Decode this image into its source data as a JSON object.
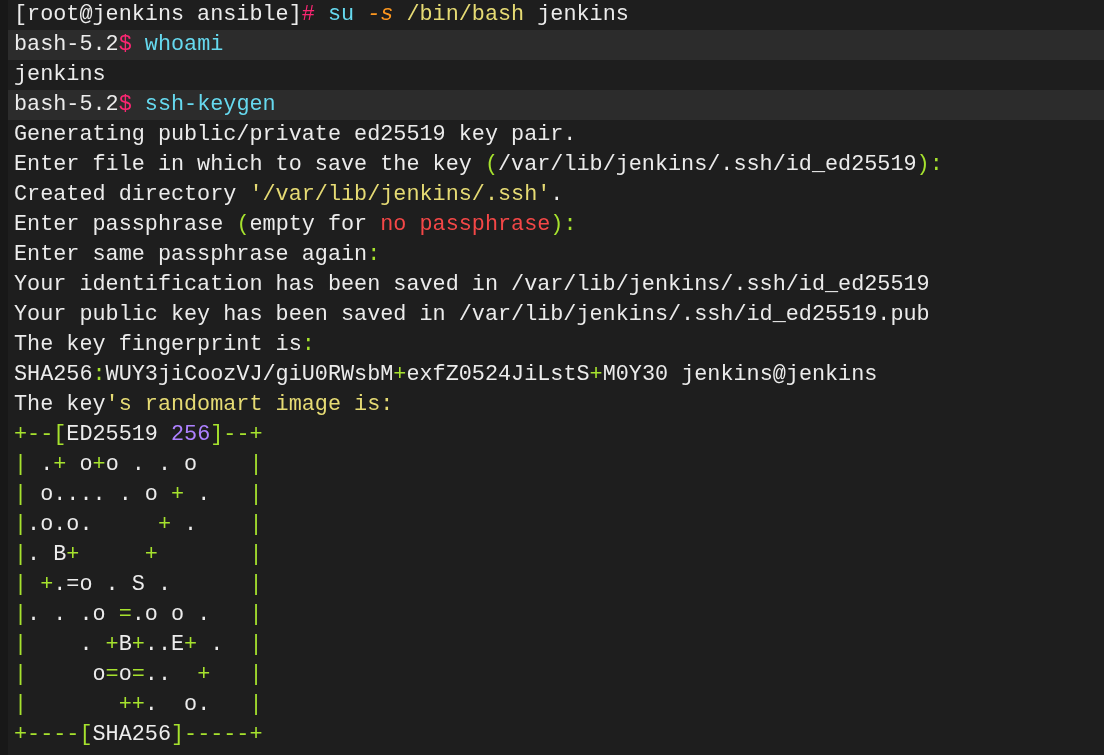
{
  "terminal": {
    "lines": [
      {
        "highlighted": false,
        "segments": [
          {
            "text": "[root@jenkins ansible]",
            "kind": "plain"
          },
          {
            "text": "#",
            "kind": "prompt"
          },
          {
            "text": " su",
            "kind": "command"
          },
          {
            "text": " -s",
            "kind": "flag"
          },
          {
            "text": " /bin/bash",
            "kind": "string"
          },
          {
            "text": " jenkins",
            "kind": "plain"
          }
        ]
      },
      {
        "highlighted": true,
        "segments": [
          {
            "text": "bash-5.2",
            "kind": "plain"
          },
          {
            "text": "$",
            "kind": "prompt"
          },
          {
            "text": " whoami",
            "kind": "command"
          }
        ]
      },
      {
        "highlighted": false,
        "segments": [
          {
            "text": "jenkins",
            "kind": "plain"
          }
        ]
      },
      {
        "highlighted": true,
        "segments": [
          {
            "text": "bash-5.2",
            "kind": "plain"
          },
          {
            "text": "$",
            "kind": "prompt"
          },
          {
            "text": " ssh-keygen",
            "kind": "command"
          }
        ]
      },
      {
        "highlighted": false,
        "segments": [
          {
            "text": "Generating public/private ed25519 key pair.",
            "kind": "plain"
          }
        ]
      },
      {
        "highlighted": false,
        "segments": [
          {
            "text": "Enter file in which to save the key ",
            "kind": "plain"
          },
          {
            "text": "(",
            "kind": "punct"
          },
          {
            "text": "/var/lib/jenkins/.ssh/id_ed25519",
            "kind": "plain"
          },
          {
            "text": "):",
            "kind": "punct"
          }
        ]
      },
      {
        "highlighted": false,
        "segments": [
          {
            "text": "Created directory ",
            "kind": "plain"
          },
          {
            "text": "'/var/lib/jenkins/.ssh'",
            "kind": "string"
          },
          {
            "text": ".",
            "kind": "plain"
          }
        ]
      },
      {
        "highlighted": false,
        "segments": [
          {
            "text": "Enter passphrase ",
            "kind": "plain"
          },
          {
            "text": "(",
            "kind": "punct"
          },
          {
            "text": "empty for ",
            "kind": "plain"
          },
          {
            "text": "no passphrase",
            "kind": "error"
          },
          {
            "text": "):",
            "kind": "punct"
          }
        ]
      },
      {
        "highlighted": false,
        "segments": [
          {
            "text": "Enter same passphrase again",
            "kind": "plain"
          },
          {
            "text": ":",
            "kind": "punct"
          }
        ]
      },
      {
        "highlighted": false,
        "segments": [
          {
            "text": "Your identification has been saved in /var/lib/jenkins/.ssh/id_ed25519",
            "kind": "plain"
          }
        ]
      },
      {
        "highlighted": false,
        "segments": [
          {
            "text": "Your public key has been saved in /var/lib/jenkins/.ssh/id_ed25519.pub",
            "kind": "plain"
          }
        ]
      },
      {
        "highlighted": false,
        "segments": [
          {
            "text": "The key fingerprint is",
            "kind": "plain"
          },
          {
            "text": ":",
            "kind": "punct"
          }
        ]
      },
      {
        "highlighted": false,
        "segments": [
          {
            "text": "SHA256",
            "kind": "plain"
          },
          {
            "text": ":",
            "kind": "punct"
          },
          {
            "text": "WUY3jiCoozVJ/giU0RWsbM",
            "kind": "plain"
          },
          {
            "text": "+",
            "kind": "punct"
          },
          {
            "text": "exfZ0524JiLstS",
            "kind": "plain"
          },
          {
            "text": "+",
            "kind": "punct"
          },
          {
            "text": "M0Y30 jenkins@jenkins",
            "kind": "plain"
          }
        ]
      },
      {
        "highlighted": false,
        "segments": [
          {
            "text": "The key",
            "kind": "plain"
          },
          {
            "text": "'s randomart image is:",
            "kind": "string"
          }
        ]
      },
      {
        "highlighted": false,
        "segments": [
          {
            "text": "+--[",
            "kind": "punct"
          },
          {
            "text": "ED25519 ",
            "kind": "plain"
          },
          {
            "text": "256",
            "kind": "number"
          },
          {
            "text": "]--+",
            "kind": "punct"
          }
        ]
      },
      {
        "highlighted": false,
        "segments": [
          {
            "text": "|",
            "kind": "punct"
          },
          {
            "text": " .",
            "kind": "plain"
          },
          {
            "text": "+",
            "kind": "punct"
          },
          {
            "text": " o",
            "kind": "plain"
          },
          {
            "text": "+",
            "kind": "punct"
          },
          {
            "text": "o . . o    ",
            "kind": "plain"
          },
          {
            "text": "|",
            "kind": "punct"
          }
        ]
      },
      {
        "highlighted": false,
        "segments": [
          {
            "text": "|",
            "kind": "punct"
          },
          {
            "text": " o.... . o ",
            "kind": "plain"
          },
          {
            "text": "+",
            "kind": "punct"
          },
          {
            "text": " .   ",
            "kind": "plain"
          },
          {
            "text": "|",
            "kind": "punct"
          }
        ]
      },
      {
        "highlighted": false,
        "segments": [
          {
            "text": "|",
            "kind": "punct"
          },
          {
            "text": ".o.o.     ",
            "kind": "plain"
          },
          {
            "text": "+",
            "kind": "punct"
          },
          {
            "text": " .    ",
            "kind": "plain"
          },
          {
            "text": "|",
            "kind": "punct"
          }
        ]
      },
      {
        "highlighted": false,
        "segments": [
          {
            "text": "|",
            "kind": "punct"
          },
          {
            "text": ". B",
            "kind": "plain"
          },
          {
            "text": "+     +       |",
            "kind": "punct"
          }
        ]
      },
      {
        "highlighted": false,
        "segments": [
          {
            "text": "| +",
            "kind": "punct"
          },
          {
            "text": ".=o . S .      ",
            "kind": "plain"
          },
          {
            "text": "|",
            "kind": "punct"
          }
        ]
      },
      {
        "highlighted": false,
        "segments": [
          {
            "text": "|",
            "kind": "punct"
          },
          {
            "text": ". . .o ",
            "kind": "plain"
          },
          {
            "text": "=",
            "kind": "punct"
          },
          {
            "text": ".o o .   ",
            "kind": "plain"
          },
          {
            "text": "|",
            "kind": "punct"
          }
        ]
      },
      {
        "highlighted": false,
        "segments": [
          {
            "text": "|",
            "kind": "punct"
          },
          {
            "text": "    . ",
            "kind": "plain"
          },
          {
            "text": "+",
            "kind": "punct"
          },
          {
            "text": "B",
            "kind": "plain"
          },
          {
            "text": "+",
            "kind": "punct"
          },
          {
            "text": "..E",
            "kind": "plain"
          },
          {
            "text": "+",
            "kind": "punct"
          },
          {
            "text": " .  ",
            "kind": "plain"
          },
          {
            "text": "|",
            "kind": "punct"
          }
        ]
      },
      {
        "highlighted": false,
        "segments": [
          {
            "text": "|",
            "kind": "punct"
          },
          {
            "text": "     o",
            "kind": "plain"
          },
          {
            "text": "=",
            "kind": "punct"
          },
          {
            "text": "o",
            "kind": "plain"
          },
          {
            "text": "=",
            "kind": "punct"
          },
          {
            "text": "..  ",
            "kind": "plain"
          },
          {
            "text": "+   |",
            "kind": "punct"
          }
        ]
      },
      {
        "highlighted": false,
        "segments": [
          {
            "text": "|       ++",
            "kind": "punct"
          },
          {
            "text": ".  o.   ",
            "kind": "plain"
          },
          {
            "text": "|",
            "kind": "punct"
          }
        ]
      },
      {
        "highlighted": false,
        "segments": [
          {
            "text": "+----[",
            "kind": "punct"
          },
          {
            "text": "SHA256",
            "kind": "plain"
          },
          {
            "text": "]-----+",
            "kind": "punct"
          }
        ]
      }
    ]
  }
}
